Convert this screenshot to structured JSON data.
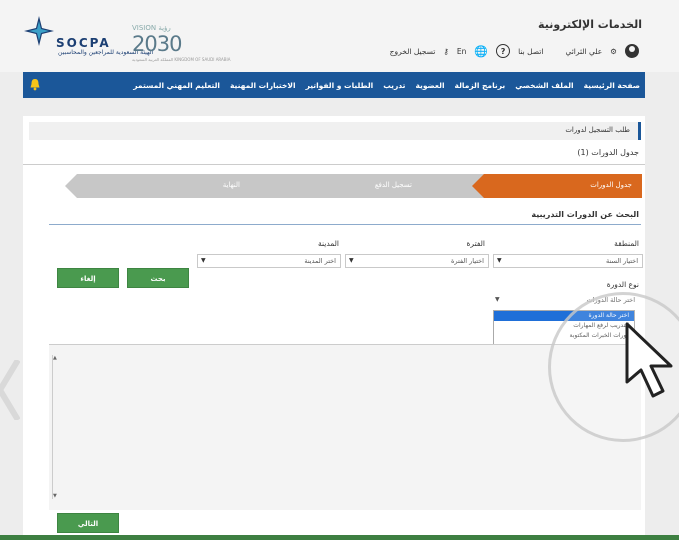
{
  "header": {
    "title": "الخدمات الإلكترونية",
    "logo_text": "SOCPA",
    "logo_subtitle": "الهيئة السعودية للمراجعين والمحاسبين",
    "vision_top": "رؤية",
    "vision_label": "VISION",
    "vision_number": "2030",
    "vision_sub": "المملكة العربية السعودية KINGDOM OF SAUDI ARABIA",
    "user_name": "علي الثرائي",
    "contact": "اتصل بنا",
    "lang": "En",
    "logout": "تسجيل الخروج"
  },
  "nav": {
    "items": [
      "صفحة الرئيسية",
      "الملف الشخصي",
      "برنامج الزمالة",
      "العضوية",
      "تدريب",
      "الطلبات و الفواتير",
      "الاختبارات المهنية",
      "التعليم المهني المستمر"
    ]
  },
  "page": {
    "title": "طلب التسجيل لدورات",
    "section": "جدول الدورات (1)",
    "steps": [
      "جدول الدورات",
      "تسجيل الدفع",
      "النهاية"
    ],
    "search_title": "البحث عن الدورات التدريبية"
  },
  "form": {
    "region_label": "المنطقة",
    "region_value": "اختيار السنة",
    "period_label": "الفترة",
    "period_value": "اختيار الفترة",
    "city_label": "المدينة",
    "city_value": "اختر المدينة",
    "type_label": "نوع الدورة",
    "type_value": "اختر حالة الدورات",
    "search_button": "بحث",
    "cancel_button": "إلغاء",
    "dropdown_options": [
      "اختر حالة الدورة",
      "التدريب لرفع المهارات",
      "دورات الخبرات المكتوبة"
    ]
  },
  "footer": {
    "next_button": "التالي"
  },
  "colors": {
    "nav": "#1b5799",
    "step_active": "#d9681e",
    "button": "#4a9a4f"
  }
}
